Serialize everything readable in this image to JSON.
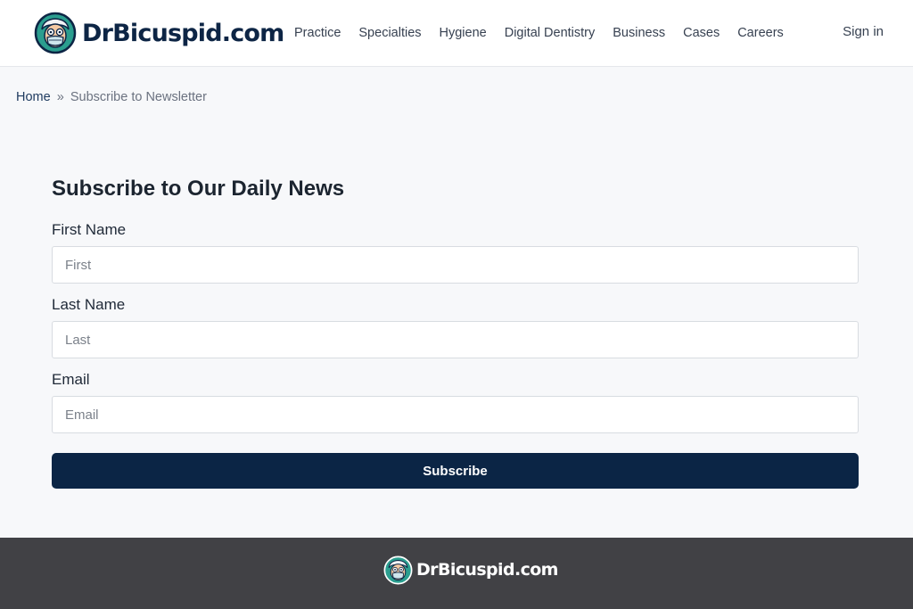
{
  "header": {
    "logo_text": "DrBicuspid.com",
    "nav": [
      "Practice",
      "Specialties",
      "Hygiene",
      "Digital Dentistry",
      "Business",
      "Cases",
      "Careers"
    ],
    "sign_in": "Sign in"
  },
  "breadcrumb": {
    "home": "Home",
    "separator": "»",
    "current": "Subscribe to Newsletter"
  },
  "form": {
    "title": "Subscribe to Our Daily News",
    "first_name": {
      "label": "First Name",
      "placeholder": "First",
      "value": ""
    },
    "last_name": {
      "label": "Last Name",
      "placeholder": "Last",
      "value": ""
    },
    "email": {
      "label": "Email",
      "placeholder": "Email",
      "value": ""
    },
    "submit_label": "Subscribe"
  },
  "footer": {
    "logo_text": "DrBicuspid.com"
  },
  "colors": {
    "brand_navy": "#0b2545",
    "footer_bg": "#414145",
    "page_bg": "#f7f8fa",
    "logo_teal": "#2b9e8f"
  },
  "icons": {
    "logo": "dentist-mascot-icon"
  }
}
